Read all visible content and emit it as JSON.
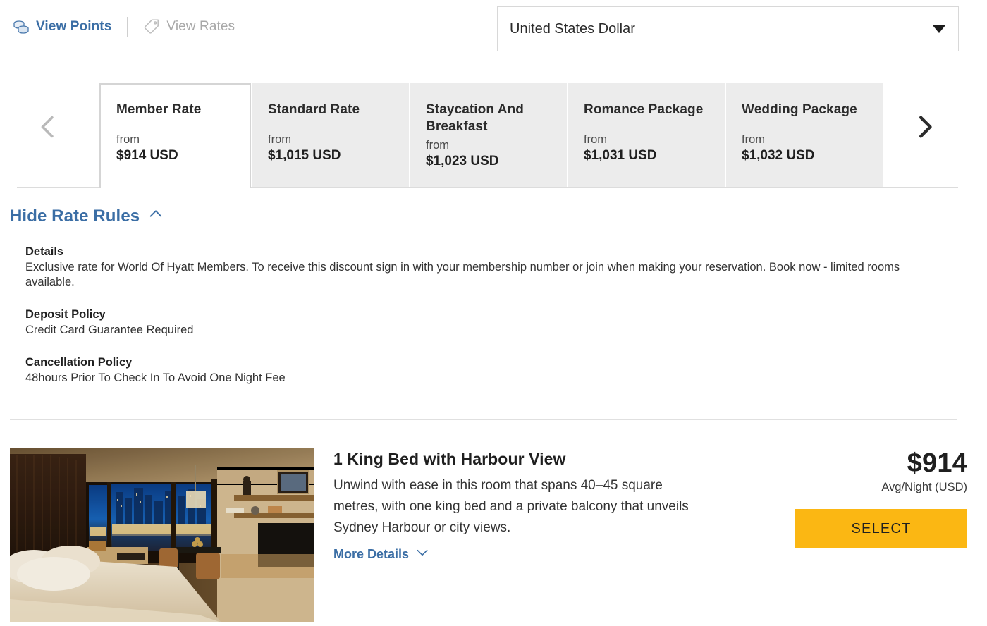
{
  "topbar": {
    "view_points": {
      "label": "View Points",
      "icon": "coins-icon",
      "color": "#3b6ea5"
    },
    "view_rates": {
      "label": "View Rates",
      "icon": "price-tag-icon",
      "color": "#a8a8a8"
    },
    "currency": {
      "selected": "United States Dollar",
      "placeholder": "Select currency",
      "caret_icon": "chevron-down-icon"
    }
  },
  "carousel": {
    "prev_icon": "chevron-left-icon",
    "next_icon": "chevron-right-icon",
    "prev_enabled": false,
    "next_enabled": true,
    "from_label": "from",
    "tabs": [
      {
        "name": "Member Rate",
        "from": "from",
        "price": "$914 USD",
        "active": true
      },
      {
        "name": "Standard Rate",
        "from": "from",
        "price": "$1,015 USD",
        "active": false
      },
      {
        "name": "Staycation And Breakfast",
        "from": "from",
        "price": "$1,023 USD",
        "active": false
      },
      {
        "name": "Romance Package",
        "from": "from",
        "price": "$1,031 USD",
        "active": false
      },
      {
        "name": "Wedding Package",
        "from": "from",
        "price": "$1,032 USD",
        "active": false
      }
    ]
  },
  "rate_rules": {
    "toggle_label": "Hide Rate Rules",
    "toggle_icon": "chevron-up-icon",
    "expanded": true,
    "blocks": [
      {
        "title": "Details",
        "text": "Exclusive rate for World Of Hyatt Members. To receive this discount sign in with your membership number or join when making your reservation. Book now - limited rooms available."
      },
      {
        "title": "Deposit Policy",
        "text": "Credit Card Guarantee Required"
      },
      {
        "title": "Cancellation Policy",
        "text": "48hours Prior To Check In To Avoid One Night Fee"
      }
    ]
  },
  "room": {
    "photo_alt": "hotel-room-with-harbour-view",
    "title": "1 King Bed with Harbour View",
    "description": "Unwind with ease in this room that spans 40–45 square metres, with one king bed and a private balcony that unveils Sydney Harbour or city views.",
    "more_details_label": "More Details",
    "more_details_icon": "chevron-down-icon",
    "price": "$914",
    "price_caption": "Avg/Night (USD)",
    "select_label": "SELECT",
    "select_color": "#fbb713"
  }
}
